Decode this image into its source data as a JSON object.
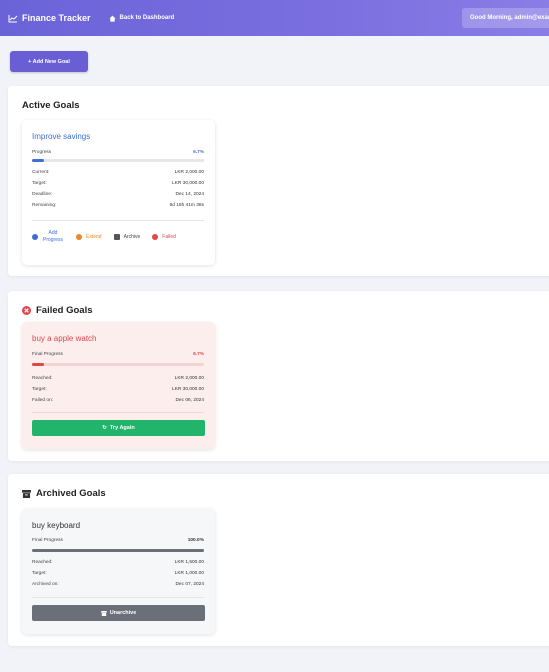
{
  "topbar": {
    "brand": "Finance Tracker",
    "brand_icon": "chart-line-icon",
    "back_label": "Back to Dashboard",
    "back_icon": "home-icon",
    "greeting": "Good Morning, admin@example.com"
  },
  "add_goal_button": "+ Add New Goal",
  "colors": {
    "accent": "#6a5ed4",
    "progress_blue": "#3b6fd8",
    "failed_red": "#e0464a",
    "success_green": "#22b46a",
    "archived_gray": "#6b7078"
  },
  "active": {
    "title": "Active Goals",
    "goal": {
      "name": "Improve savings",
      "progress_label": "Progress",
      "progress_pct": "6.7%",
      "progress_fraction": 0.067,
      "current_label": "Current:",
      "current": "LKR 2,000.00",
      "target_label": "Target:",
      "target": "LKR 30,000.00",
      "deadline_label": "Deadline:",
      "deadline": "Dec 14, 2024",
      "remaining_label": "Remaining:",
      "remaining": "6d 18h 41m 38s",
      "actions": {
        "add_progress": "Add Progress",
        "extend": "Extend",
        "archive": "Archive",
        "failed": "Failed"
      }
    }
  },
  "failed": {
    "title": "Failed Goals",
    "goal": {
      "name": "buy a apple watch",
      "progress_label": "Final Progress",
      "progress_pct": "6.7%",
      "progress_fraction": 0.067,
      "reached_label": "Reached:",
      "reached": "LKR 2,000.00",
      "target_label": "Target:",
      "target": "LKR 30,000.00",
      "failed_on_label": "Failed on:",
      "failed_on": "Dec 06, 2024",
      "try_again": "Try Again"
    }
  },
  "archived": {
    "title": "Archived Goals",
    "goal": {
      "name": "buy keyboard",
      "progress_label": "Final Progress",
      "progress_pct": "100.0%",
      "progress_fraction": 1.0,
      "reached_label": "Reached:",
      "reached": "LKR 1,500.00",
      "target_label": "Target:",
      "target": "LKR 1,000.00",
      "archived_on_label": "Archived on:",
      "archived_on": "Dec 07, 2024",
      "unarchive": "Unarchive"
    }
  }
}
